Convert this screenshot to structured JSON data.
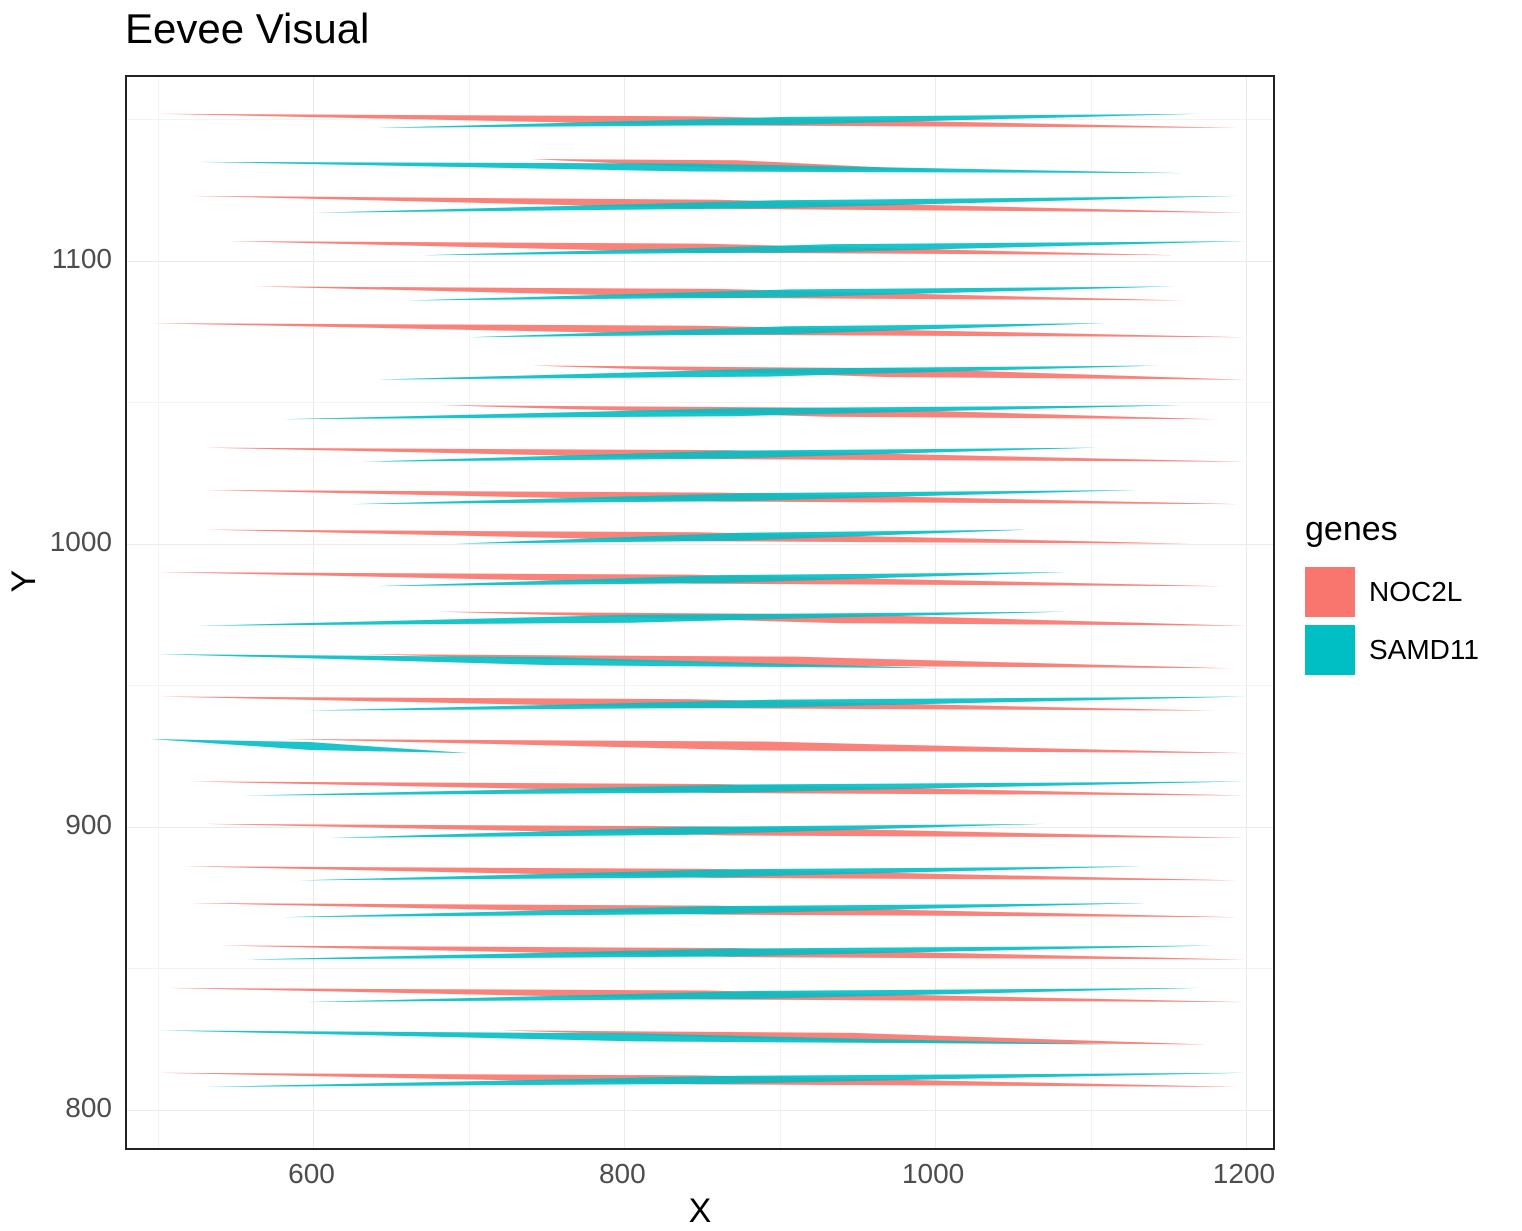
{
  "chart_data": {
    "type": "line",
    "title": "Eevee Visual",
    "xlabel": "X",
    "ylabel": "Y",
    "x_ticks": [
      600,
      800,
      1000,
      1200
    ],
    "y_ticks": [
      800,
      900,
      1000,
      1100
    ],
    "x_minor": [
      500,
      700,
      900,
      1100
    ],
    "y_minor": [
      850,
      950,
      1050,
      1150
    ],
    "xlim": [
      480,
      1220
    ],
    "ylim": [
      785,
      1165
    ],
    "legend_title": "genes",
    "series": [
      {
        "name": "NOC2L",
        "color": "#F8766D"
      },
      {
        "name": "SAMD11",
        "color": "#00BFC4"
      }
    ],
    "rows": [
      {
        "noc2l": {
          "y0": 1152,
          "y1": 1147,
          "x0": 500,
          "x1": 1195
        },
        "samd11": {
          "y0": 1147,
          "y1": 1152,
          "x0": 640,
          "x1": 1170
        }
      },
      {
        "noc2l": {
          "y0": 1136,
          "y1": 1132,
          "x0": 740,
          "x1": 1005
        },
        "samd11": {
          "y0": 1135,
          "y1": 1131,
          "x0": 525,
          "x1": 1160
        }
      },
      {
        "noc2l": {
          "y0": 1123,
          "y1": 1117,
          "x0": 520,
          "x1": 1200
        },
        "samd11": {
          "y0": 1117,
          "y1": 1123,
          "x0": 600,
          "x1": 1195
        }
      },
      {
        "noc2l": {
          "y0": 1107,
          "y1": 1102,
          "x0": 545,
          "x1": 1155
        },
        "samd11": {
          "y0": 1102,
          "y1": 1107,
          "x0": 670,
          "x1": 1200
        }
      },
      {
        "noc2l": {
          "y0": 1091,
          "y1": 1086,
          "x0": 560,
          "x1": 1160
        },
        "samd11": {
          "y0": 1086,
          "y1": 1091,
          "x0": 660,
          "x1": 1155
        }
      },
      {
        "noc2l": {
          "y0": 1078,
          "y1": 1073,
          "x0": 495,
          "x1": 1200
        },
        "samd11": {
          "y0": 1073,
          "y1": 1078,
          "x0": 700,
          "x1": 1110
        }
      },
      {
        "noc2l": {
          "y0": 1063,
          "y1": 1058,
          "x0": 740,
          "x1": 1200
        },
        "samd11": {
          "y0": 1058,
          "y1": 1063,
          "x0": 640,
          "x1": 1145
        }
      },
      {
        "noc2l": {
          "y0": 1049,
          "y1": 1044,
          "x0": 680,
          "x1": 1180
        },
        "samd11": {
          "y0": 1044,
          "y1": 1049,
          "x0": 580,
          "x1": 1160
        }
      },
      {
        "noc2l": {
          "y0": 1034,
          "y1": 1029,
          "x0": 530,
          "x1": 1200
        },
        "samd11": {
          "y0": 1029,
          "y1": 1034,
          "x0": 630,
          "x1": 1105
        }
      },
      {
        "noc2l": {
          "y0": 1019,
          "y1": 1014,
          "x0": 530,
          "x1": 1195
        },
        "samd11": {
          "y0": 1014,
          "y1": 1019,
          "x0": 625,
          "x1": 1130
        }
      },
      {
        "noc2l": {
          "y0": 1005,
          "y1": 1000,
          "x0": 530,
          "x1": 1165
        },
        "samd11": {
          "y0": 1000,
          "y1": 1005,
          "x0": 690,
          "x1": 1060
        }
      },
      {
        "noc2l": {
          "y0": 990,
          "y1": 985,
          "x0": 500,
          "x1": 1185
        },
        "samd11": {
          "y0": 985,
          "y1": 990,
          "x0": 640,
          "x1": 1085
        }
      },
      {
        "noc2l": {
          "y0": 976,
          "y1": 971,
          "x0": 680,
          "x1": 1200
        },
        "samd11": {
          "y0": 971,
          "y1": 976,
          "x0": 525,
          "x1": 1085
        }
      },
      {
        "noc2l": {
          "y0": 961,
          "y1": 956,
          "x0": 630,
          "x1": 1190
        },
        "samd11": {
          "y0": 961,
          "y1": 956,
          "x0": 500,
          "x1": 1005
        }
      },
      {
        "noc2l": {
          "y0": 946,
          "y1": 941,
          "x0": 500,
          "x1": 1180
        },
        "samd11": {
          "y0": 941,
          "y1": 946,
          "x0": 595,
          "x1": 1200
        }
      },
      {
        "noc2l": {
          "y0": 931,
          "y1": 926,
          "x0": 580,
          "x1": 1200
        },
        "samd11": {
          "y0": 931,
          "y1": 926,
          "x0": 495,
          "x1": 700
        }
      },
      {
        "noc2l": {
          "y0": 916,
          "y1": 911,
          "x0": 520,
          "x1": 1200
        },
        "samd11": {
          "y0": 911,
          "y1": 916,
          "x0": 555,
          "x1": 1200
        }
      },
      {
        "noc2l": {
          "y0": 901,
          "y1": 896,
          "x0": 530,
          "x1": 1200
        },
        "samd11": {
          "y0": 896,
          "y1": 901,
          "x0": 610,
          "x1": 1070
        }
      },
      {
        "noc2l": {
          "y0": 886,
          "y1": 881,
          "x0": 515,
          "x1": 1195
        },
        "samd11": {
          "y0": 881,
          "y1": 886,
          "x0": 590,
          "x1": 1135
        }
      },
      {
        "noc2l": {
          "y0": 873,
          "y1": 868,
          "x0": 520,
          "x1": 1195
        },
        "samd11": {
          "y0": 868,
          "y1": 873,
          "x0": 580,
          "x1": 1135
        }
      },
      {
        "noc2l": {
          "y0": 858,
          "y1": 853,
          "x0": 540,
          "x1": 1200
        },
        "samd11": {
          "y0": 853,
          "y1": 858,
          "x0": 555,
          "x1": 1180
        }
      },
      {
        "noc2l": {
          "y0": 843,
          "y1": 838,
          "x0": 505,
          "x1": 1200
        },
        "samd11": {
          "y0": 838,
          "y1": 843,
          "x0": 595,
          "x1": 1170
        }
      },
      {
        "noc2l": {
          "y0": 828,
          "y1": 823,
          "x0": 720,
          "x1": 1175
        },
        "samd11": {
          "y0": 828,
          "y1": 823,
          "x0": 500,
          "x1": 1115
        }
      },
      {
        "noc2l": {
          "y0": 813,
          "y1": 808,
          "x0": 500,
          "x1": 1195
        },
        "samd11": {
          "y0": 808,
          "y1": 813,
          "x0": 530,
          "x1": 1200
        }
      }
    ]
  }
}
